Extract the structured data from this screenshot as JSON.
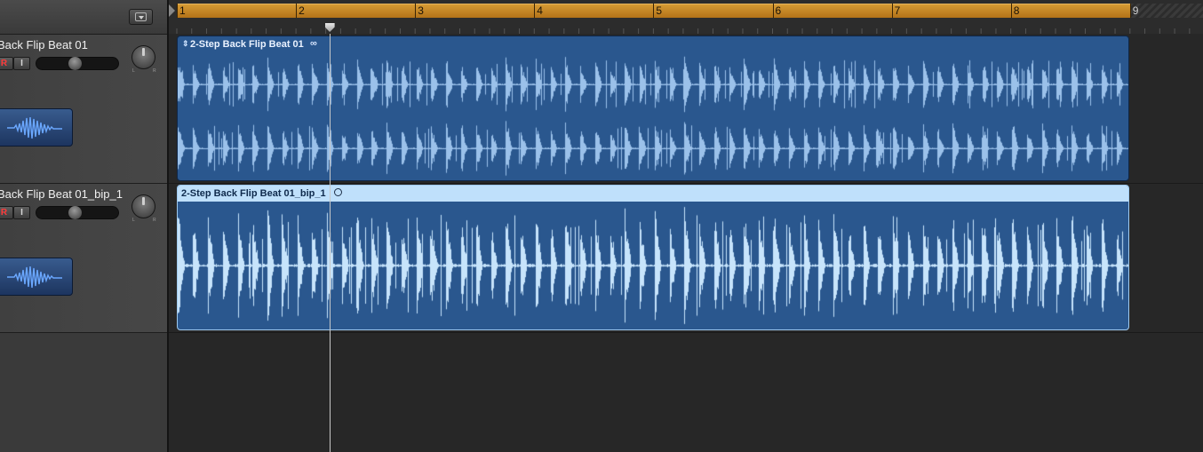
{
  "header": {
    "menu_button_icon": "chevron-down-icon"
  },
  "tracks": [
    {
      "name": "Back Flip Beat 01",
      "record_label": "R",
      "input_label": "I",
      "volume_level": 0.38,
      "pan_left": "L",
      "pan_right": "R",
      "icon": "audio-waveform-icon"
    },
    {
      "name": "Back Flip Beat 01_bip_1",
      "record_label": "R",
      "input_label": "I",
      "volume_level": 0.38,
      "pan_left": "L",
      "pan_right": "R",
      "icon": "audio-waveform-icon"
    }
  ],
  "ruler": {
    "bars": [
      "1",
      "2",
      "3",
      "4",
      "5",
      "6",
      "7",
      "8",
      "9"
    ],
    "cycle_color": "#c88b2a",
    "playhead_position_bars": 2.28
  },
  "regions": [
    {
      "title": "2-Step Back Flip Beat 01",
      "loop_icon": "loop-icon",
      "style": "stereo",
      "selected": false,
      "color": "#2a578e"
    },
    {
      "title": "2-Step Back Flip Beat 01_bip_1",
      "loop_icon": "circle-icon",
      "style": "mono",
      "selected": true,
      "color": "#b8dcf8"
    }
  ]
}
